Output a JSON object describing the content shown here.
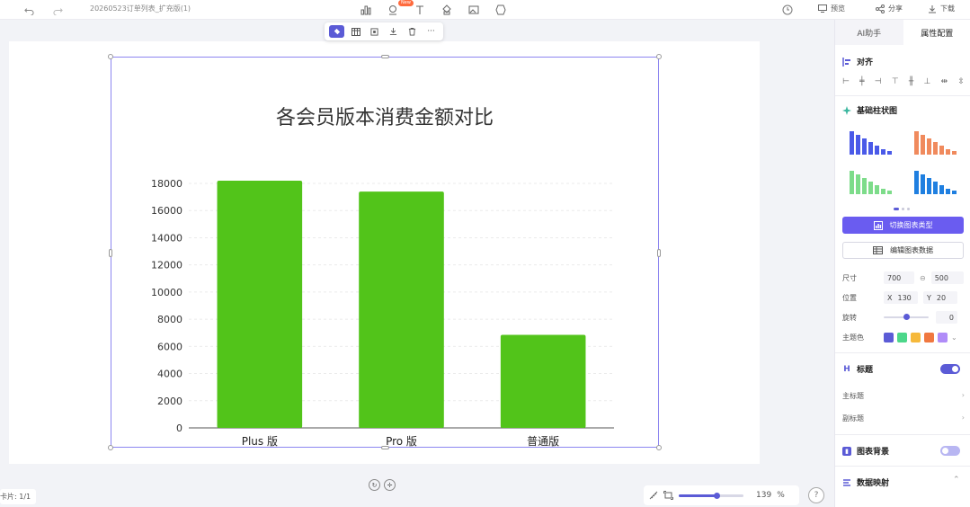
{
  "topbar": {
    "doc_title": "20260523订单列表_扩充版(1)",
    "new_badge": "New",
    "preview_label": "预览",
    "share_label": "分享",
    "download_label": "下载"
  },
  "chart_data": {
    "type": "bar",
    "title": "各会员版本消费金额对比",
    "categories": [
      "Plus 版",
      "Pro 版",
      "普通版"
    ],
    "values": [
      18200,
      17400,
      6850
    ],
    "ylim": [
      0,
      18000
    ],
    "yticks": [
      "0",
      "2000",
      "4000",
      "6000",
      "8000",
      "10000",
      "12000",
      "14000",
      "16000",
      "18000"
    ],
    "bar_color": "#52c41a",
    "grid": true,
    "xlabel": "",
    "ylabel": ""
  },
  "status": {
    "page_label": "卡片: 1/1",
    "zoom_value": "139",
    "zoom_unit": "%",
    "zoom_fraction": 0.58,
    "help": "?"
  },
  "panel": {
    "tabs": [
      "AI助手",
      "属性配置"
    ],
    "active_tab": 1,
    "align_title": "对齐",
    "chart_type_title": "基础柱状图",
    "switch_type_label": "切换图表类型",
    "edit_data_label": "编辑图表数据",
    "size_label": "尺寸",
    "width": "700",
    "height": "500",
    "position_label": "位置",
    "x_label": "X",
    "x_value": "130",
    "y_label": "Y",
    "y_value": "20",
    "rotate_label": "旋转",
    "rotate_value": "0",
    "theme_label": "主题色",
    "theme_colors": [
      "#5b5bd6",
      "#4cd78a",
      "#f6b93b",
      "#f07840",
      "#b08cf8"
    ],
    "title_section": "标题",
    "main_title_label": "主标题",
    "sub_title_label": "副标题",
    "bg_section": "图表背景",
    "mapping_section": "数据映射",
    "accent": "#6a5cf0"
  }
}
